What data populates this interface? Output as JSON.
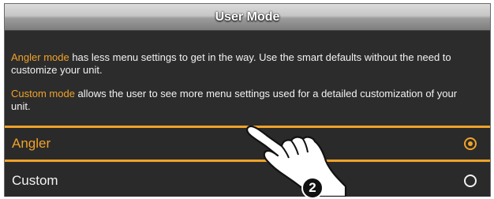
{
  "window": {
    "title": "User Mode"
  },
  "descriptions": [
    {
      "highlight": "Angler mode",
      "text": " has less menu settings to get in the way. Use the smart defaults without the need to customize your unit."
    },
    {
      "highlight": "Custom mode",
      "text": " allows the user to see more menu settings used for a detailed customization of your unit."
    }
  ],
  "options": [
    {
      "label": "Angler",
      "selected": true
    },
    {
      "label": "Custom",
      "selected": false
    }
  ],
  "callout": {
    "step": "2"
  },
  "colors": {
    "accent": "#f0a22a",
    "background": "#2c2c2c",
    "text": "#f2f2f2"
  },
  "icons": [
    "radio-selected-icon",
    "radio-unselected-icon",
    "pointing-hand-icon"
  ]
}
